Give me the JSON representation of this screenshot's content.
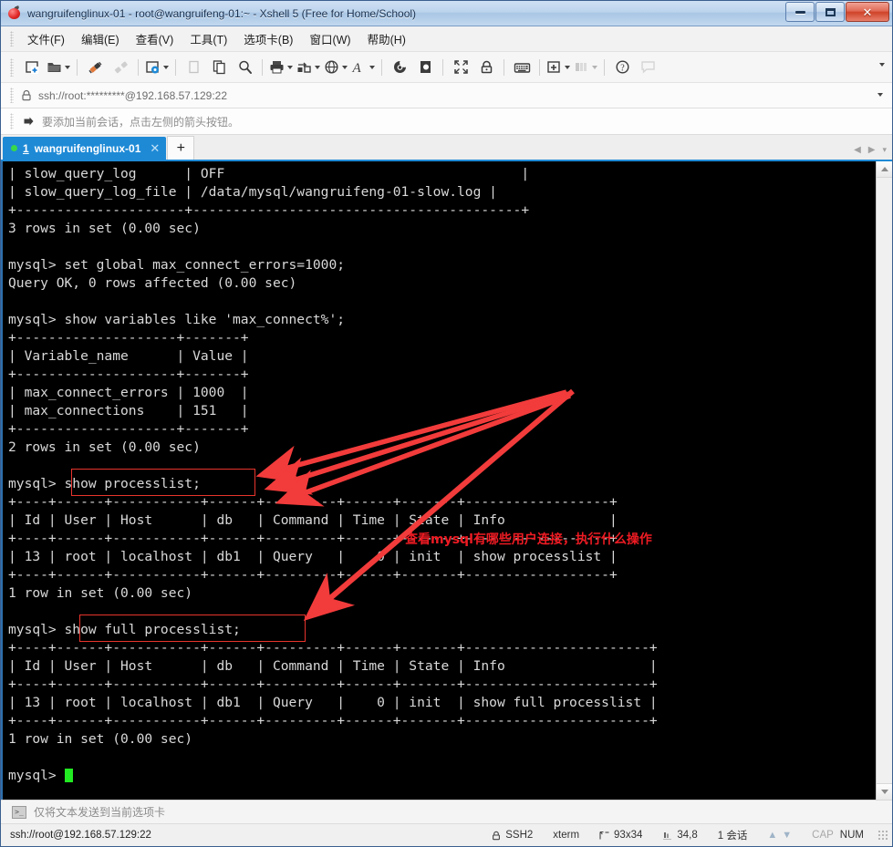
{
  "window": {
    "title": "wangruifenglinux-01 - root@wangruifeng-01:~ - Xshell 5 (Free for Home/School)",
    "app_icon": "xshell-icon",
    "minimize_label": "minimize",
    "maximize_label": "maximize",
    "close_label": "close"
  },
  "menubar": {
    "items": [
      {
        "label": "文件(F)",
        "name": "menu-file"
      },
      {
        "label": "编辑(E)",
        "name": "menu-edit"
      },
      {
        "label": "查看(V)",
        "name": "menu-view"
      },
      {
        "label": "工具(T)",
        "name": "menu-tools"
      },
      {
        "label": "选项卡(B)",
        "name": "menu-tabs"
      },
      {
        "label": "窗口(W)",
        "name": "menu-window"
      },
      {
        "label": "帮助(H)",
        "name": "menu-help"
      }
    ]
  },
  "toolbar": {
    "buttons": [
      {
        "icon": "new-session-icon",
        "name": "new-session-button",
        "dropdown": false
      },
      {
        "icon": "open-folder-icon",
        "name": "open-session-button",
        "dropdown": true
      },
      {
        "icon": "connect-plug-icon",
        "name": "connect-button",
        "dropdown": false
      },
      {
        "icon": "disconnect-plug-icon",
        "name": "disconnect-button",
        "dropdown": false
      },
      {
        "icon": "properties-gear-icon",
        "name": "properties-button",
        "dropdown": true
      },
      {
        "icon": "cut-icon",
        "name": "cut-button",
        "dropdown": false
      },
      {
        "icon": "copy-icon",
        "name": "copy-button",
        "dropdown": false
      },
      {
        "icon": "find-icon",
        "name": "find-button",
        "dropdown": false
      },
      {
        "icon": "print-icon",
        "name": "print-button",
        "dropdown": true
      },
      {
        "icon": "transfer-file-icon",
        "name": "file-transfer-button",
        "dropdown": true
      },
      {
        "icon": "globe-icon",
        "name": "web-button",
        "dropdown": true
      },
      {
        "icon": "font-icon",
        "name": "font-button",
        "dropdown": true
      },
      {
        "icon": "log-icon",
        "name": "session-log-button",
        "dropdown": false
      },
      {
        "icon": "capture-icon",
        "name": "capture-button",
        "dropdown": false
      },
      {
        "icon": "fullscreen-icon",
        "name": "fullscreen-button",
        "dropdown": false
      },
      {
        "icon": "lock-icon",
        "name": "lock-button",
        "dropdown": false
      },
      {
        "icon": "keyboard-icon",
        "name": "keyboard-button",
        "dropdown": false
      },
      {
        "icon": "add-window-icon",
        "name": "add-window-button",
        "dropdown": true
      },
      {
        "icon": "arrange-panes-icon",
        "name": "arrange-panes-button",
        "dropdown": true
      },
      {
        "icon": "help-icon",
        "name": "help-button",
        "dropdown": false
      },
      {
        "icon": "comment-icon",
        "name": "comment-button",
        "dropdown": false
      }
    ],
    "overflow_label": "▾"
  },
  "address_bar": {
    "icon": "padlock-icon",
    "value": "ssh://root:*********@192.168.57.129:22",
    "dropdown_label": "▾"
  },
  "hint_bar": {
    "icon": "arrow-to-bar-icon",
    "text": "要添加当前会话，点击左侧的箭头按钮。"
  },
  "tabs": {
    "items": [
      {
        "index": "1",
        "label": "wangruifenglinux-01",
        "close_label": "✕",
        "status": "connected"
      }
    ],
    "add_label": "+",
    "nav_prev": "◀",
    "nav_next": "▶",
    "nav_menu": "▾"
  },
  "terminal": {
    "lines": [
      "| slow_query_log      | OFF                                     |",
      "| slow_query_log_file | /data/mysql/wangruifeng-01-slow.log |",
      "+---------------------+-----------------------------------------+",
      "3 rows in set (0.00 sec)",
      "",
      "mysql> set global max_connect_errors=1000;",
      "Query OK, 0 rows affected (0.00 sec)",
      "",
      "mysql> show variables like 'max_connect%';",
      "+--------------------+-------+",
      "| Variable_name      | Value |",
      "+--------------------+-------+",
      "| max_connect_errors | 1000  |",
      "| max_connections    | 151   |",
      "+--------------------+-------+",
      "2 rows in set (0.00 sec)",
      "",
      "mysql> show processlist;",
      "+----+------+-----------+------+---------+------+-------+------------------+",
      "| Id | User | Host      | db   | Command | Time | State | Info             |",
      "+----+------+-----------+------+---------+------+-------+------------------+",
      "| 13 | root | localhost | db1  | Query   |    0 | init  | show processlist |",
      "+----+------+-----------+------+---------+------+-------+------------------+",
      "1 row in set (0.00 sec)",
      "",
      "mysql> show full processlist;",
      "+----+------+-----------+------+---------+------+-------+-----------------------+",
      "| Id | User | Host      | db   | Command | Time | State | Info                  |",
      "+----+------+-----------+------+---------+------+-------+-----------------------+",
      "| 13 | root | localhost | db1  | Query   |    0 | init  | show full processlist |",
      "+----+------+-----------+------+---------+------+-------+-----------------------+",
      "1 row in set (0.00 sec)",
      "",
      "mysql> "
    ],
    "prompt_cursor": "block-cursor",
    "fg_color": "#d9d9d9",
    "bg_color": "#000000",
    "cursor_color": "#22ea22"
  },
  "annotations": {
    "color": "#ee1b23",
    "note": "查看mysql有哪些用户连接，执行什么操作",
    "highlight_boxes": [
      {
        "name": "highlight-show-processlist",
        "command": "show processlist;"
      },
      {
        "name": "highlight-show-full-processlist",
        "command": "show full processlist;"
      }
    ]
  },
  "send_bar": {
    "icon": "terminal-prompt-icon",
    "text": "仅将文本发送到当前选项卡"
  },
  "status_bar": {
    "url": "ssh://root@192.168.57.129:22",
    "protocol_icon": "padlock-icon",
    "protocol": "SSH2",
    "emulation": "xterm",
    "size_icon": "screen-size-icon",
    "size": "93x34",
    "cursor_icon": "cursor-pos-icon",
    "cursor_pos": "34,8",
    "sessions": "1 会话",
    "upload_icon": "arrow-up-icon",
    "download_icon": "arrow-down-icon",
    "caps": "CAP",
    "num": "NUM"
  }
}
